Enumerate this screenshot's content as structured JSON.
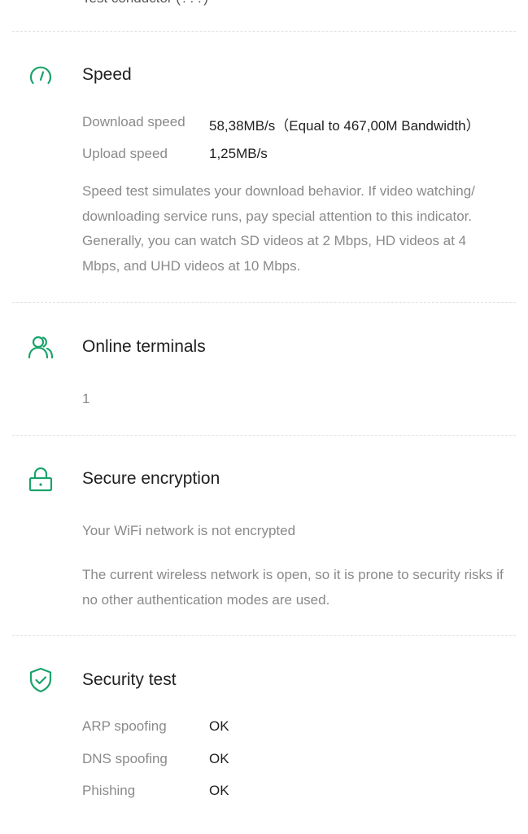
{
  "top_cutoff": {
    "text": "Test conductor (???)"
  },
  "sections": {
    "speed": {
      "title": "Speed",
      "icon": "speedometer-icon",
      "rows": [
        {
          "label": "Download speed",
          "value": "58,38MB/s（Equal to 467,00M Bandwidth）"
        },
        {
          "label": "Upload speed",
          "value": "1,25MB/s"
        }
      ],
      "description": "Speed test simulates your download behavior. If video watching/ downloading service runs, pay special attention to this indicator. Generally, you can watch SD videos at 2 Mbps, HD videos at 4 Mbps, and UHD videos at 10 Mbps."
    },
    "terminals": {
      "title": "Online terminals",
      "icon": "users-icon",
      "count": "1"
    },
    "encryption": {
      "title": "Secure encryption",
      "icon": "lock-icon",
      "status": "Your WiFi network is not encrypted",
      "description": "The current wireless network is open, so it is prone to security risks if no other authentication modes are used."
    },
    "security": {
      "title": "Security test",
      "icon": "shield-check-icon",
      "rows": [
        {
          "label": "ARP spoofing",
          "value": "OK"
        },
        {
          "label": "DNS spoofing",
          "value": "OK"
        },
        {
          "label": "Phishing",
          "value": "OK"
        }
      ]
    }
  },
  "colors": {
    "accent": "#1aa36a",
    "divider": "#e2e2e2",
    "title_text": "#1f1f1f",
    "secondary_text": "#8a8a8a"
  }
}
